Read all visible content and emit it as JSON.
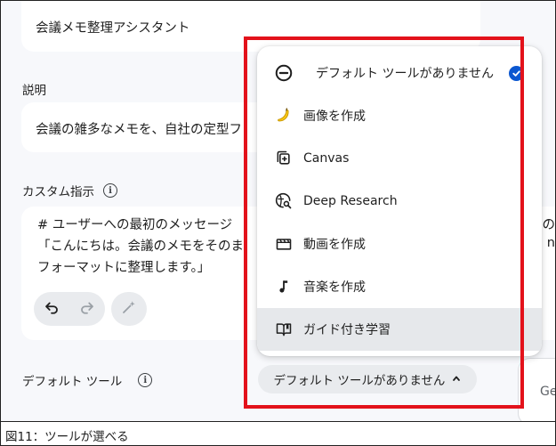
{
  "name_field": {
    "value": "会議メモ整理アシスタント"
  },
  "description": {
    "label": "説明",
    "value": "会議の雑多なメモを、自社の定型フ"
  },
  "custom_instructions": {
    "label": "カスタム指示",
    "line1": "# ユーザーへの最初のメッセージ",
    "line1_right": "最の",
    "line2": "「こんにちは。会議のメモをそのま",
    "line2_right": "n",
    "line3": "フォーマットに整理します。」"
  },
  "default_tools": {
    "label": "デフォルト ツール",
    "chip_label": "デフォルト ツールがありません",
    "menu": [
      {
        "icon": "no-tool-icon",
        "label": "デフォルト ツールがありません",
        "selected": true
      },
      {
        "icon": "banana-icon",
        "label": "画像を作成",
        "selected": false
      },
      {
        "icon": "canvas-icon",
        "label": "Canvas",
        "selected": false
      },
      {
        "icon": "deep-research-icon",
        "label": "Deep Research",
        "selected": false
      },
      {
        "icon": "video-icon",
        "label": "動画を作成",
        "selected": false
      },
      {
        "icon": "music-note-icon",
        "label": "音楽を作成",
        "selected": false
      },
      {
        "icon": "guided-learning-icon",
        "label": "ガイド付き学習",
        "selected": false
      }
    ]
  },
  "side_card": {
    "text": "Ge"
  },
  "caption": "図11：ツールが選べる",
  "colors": {
    "accent": "#0b57d0",
    "highlight_box": "#e3121b",
    "menu_hover": "#e6e8eb"
  }
}
